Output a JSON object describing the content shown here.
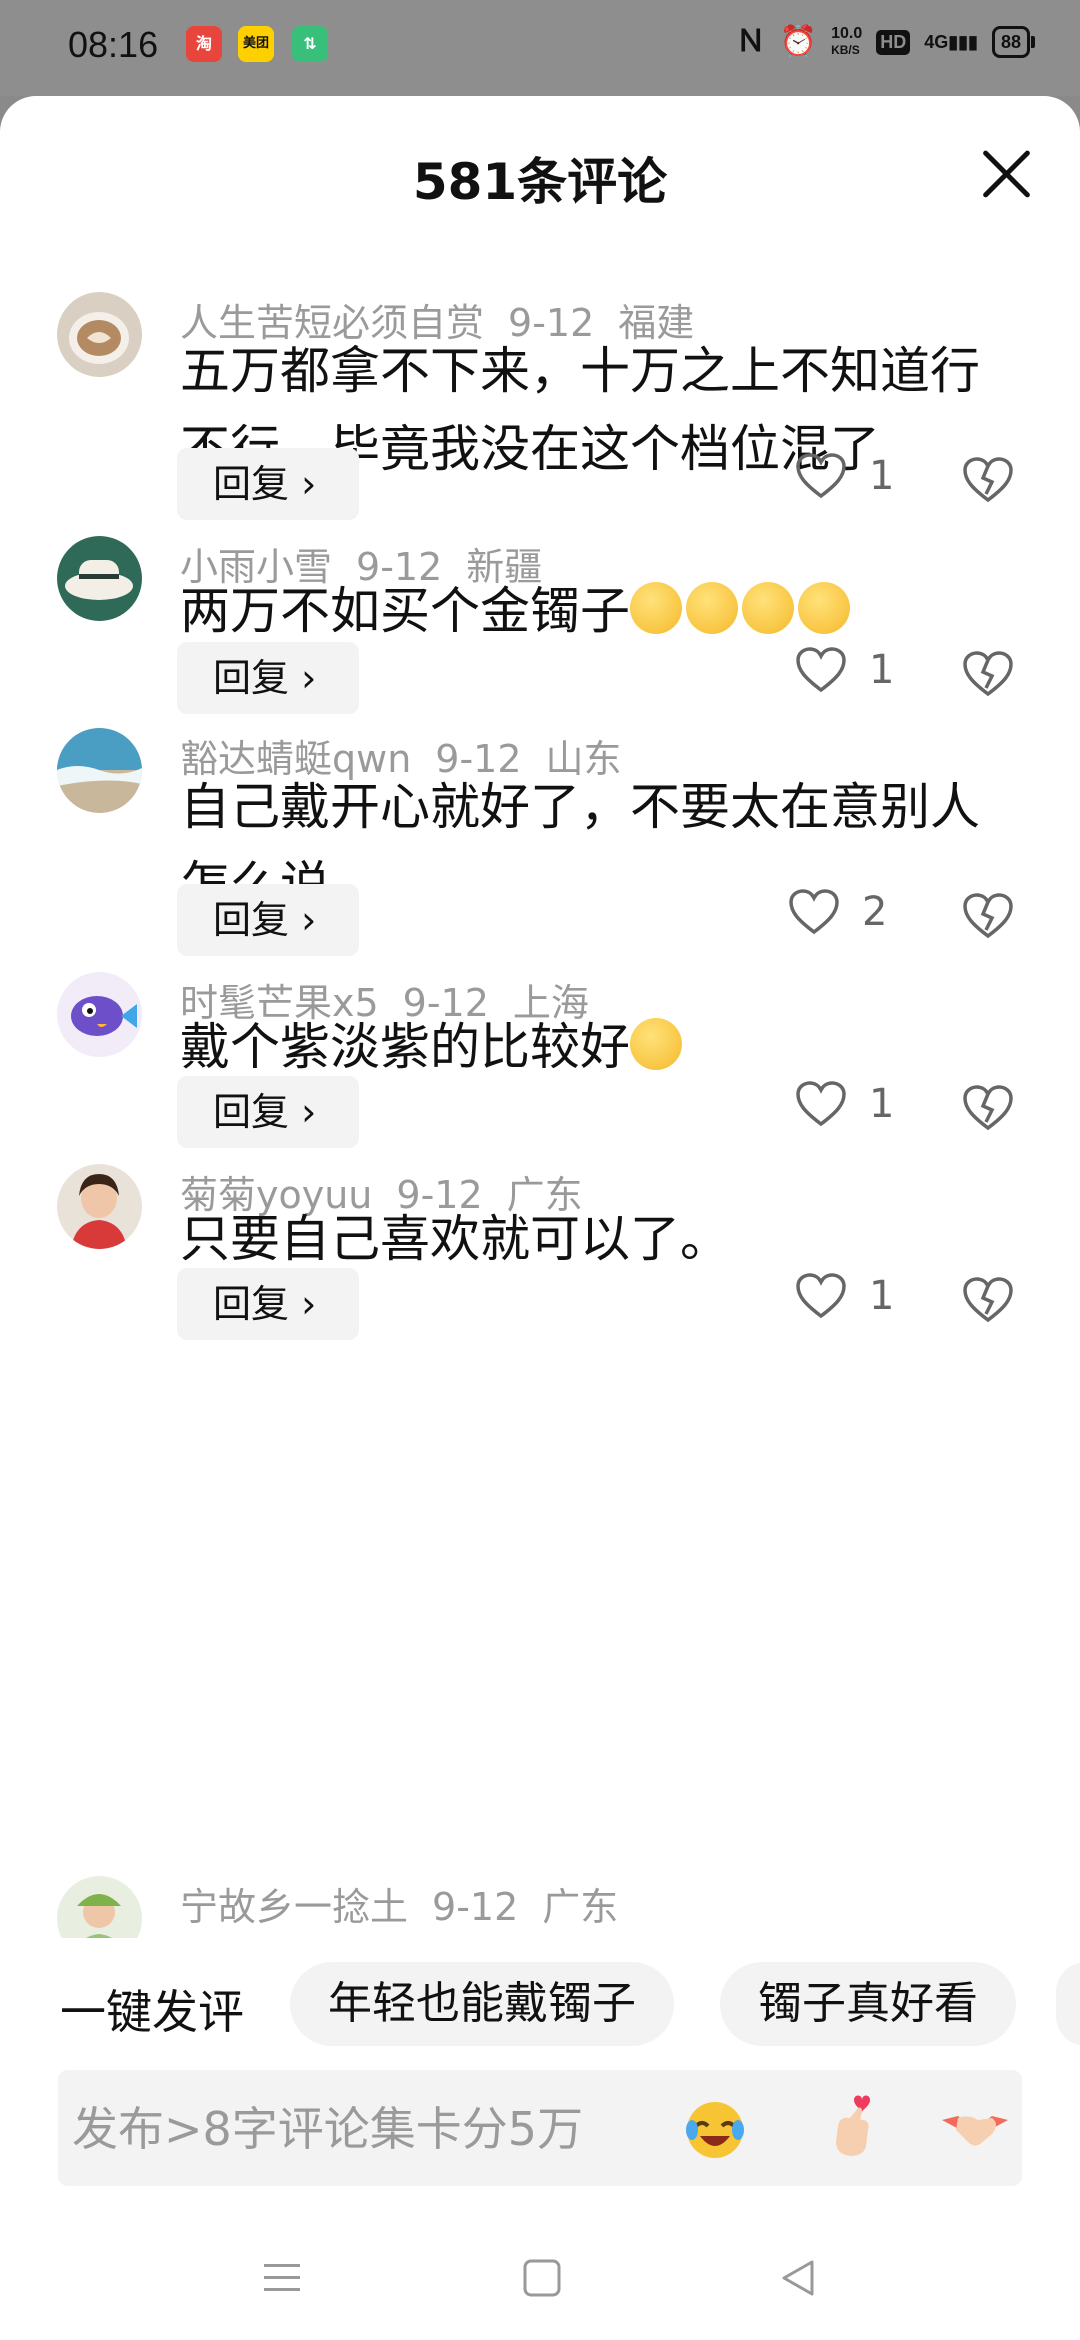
{
  "status_bar": {
    "time": "08:16",
    "app_icons": [
      "淘",
      "美团",
      "⇅"
    ],
    "speed_value": "10.0",
    "speed_unit": "KB/S",
    "hd": "HD",
    "network": "4G",
    "battery": "88"
  },
  "sheet": {
    "title": "581条评论"
  },
  "comments": [
    {
      "user": "人生苦短必须自赏",
      "date": "9-12",
      "location": "福建",
      "text": "五万都拿不下来，十万之上不知道行不行，毕竟我没在这个档位混了",
      "reply_label": "回复 ›",
      "likes": "1",
      "avatar_color": "#c7b8a4"
    },
    {
      "user": "小雨小雪",
      "date": "9-12",
      "location": "新疆",
      "text": "两万不如买个金镯子",
      "reply_label": "回复 ›",
      "likes": "1",
      "avatar_color": "#3e6e5c"
    },
    {
      "user": "豁达蜻蜓qwn",
      "date": "9-12",
      "location": "山东",
      "text": "自己戴开心就好了，不要太在意别人怎么说。",
      "reply_label": "回复 ›",
      "likes": "2",
      "avatar_color": "#5fa7c7"
    },
    {
      "user": "时髦芒果x5",
      "date": "9-12",
      "location": "上海",
      "text": "戴个紫淡紫的比较好",
      "reply_label": "回复 ›",
      "likes": "1",
      "avatar_color": "#6d4fc9"
    },
    {
      "user": "菊菊yoyuu",
      "date": "9-12",
      "location": "广东",
      "text": "只要自己喜欢就可以了。",
      "reply_label": "回复 ›",
      "likes": "1",
      "avatar_color": "#c87a5e"
    },
    {
      "user": "宁故乡一捻土",
      "date": "9-12",
      "location": "广东",
      "avatar_color": "#9bc27a"
    }
  ],
  "quick_comment": {
    "label": "一键发评",
    "chips": [
      "年轻也能戴镯子",
      "镯子真好看"
    ]
  },
  "composer": {
    "placeholder": "发布>8字评论集卡分5万"
  },
  "colors": {
    "status_bar_bg": "#8e8e8e",
    "meta_text": "#9a9a9a",
    "chip_bg": "#f3f3f3"
  }
}
